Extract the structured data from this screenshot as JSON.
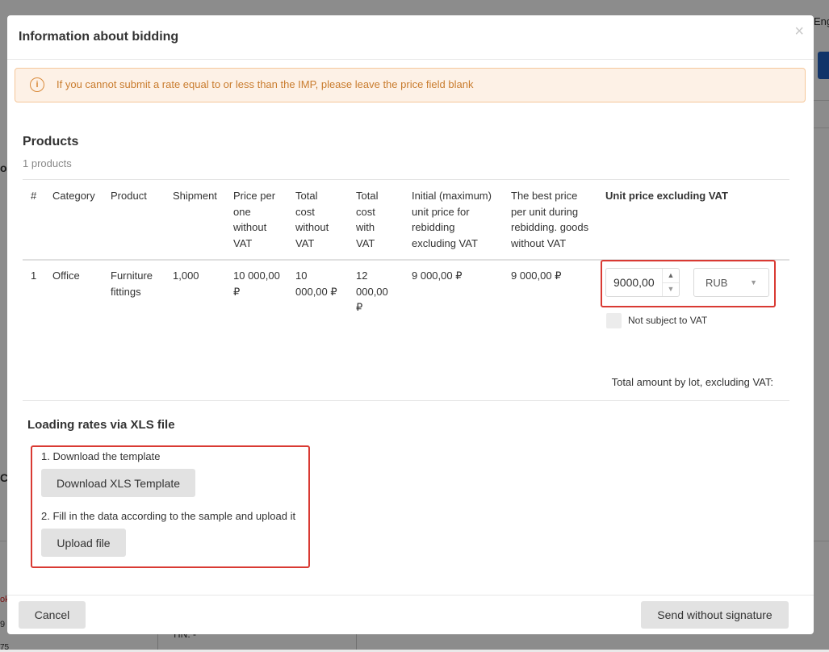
{
  "background": {
    "lang": "Eng",
    "frag_o": "o",
    "frag_c": "C",
    "frag_ok": "ok",
    "frag_9": "9",
    "frag_75": "75",
    "frag_tin": "TIN: -"
  },
  "modal": {
    "title": "Information about bidding",
    "close_icon": "×"
  },
  "alert": {
    "icon": "i",
    "text": "If you cannot submit a rate equal to or less than the IMP, please leave the price field blank"
  },
  "products": {
    "title": "Products",
    "count": "1 products",
    "headers": {
      "num": "#",
      "category": "Category",
      "product": "Product",
      "shipment": "Shipment",
      "price_per_one": [
        "Price per",
        "one",
        "without",
        "VAT"
      ],
      "total_without": [
        "Total",
        "cost",
        "without",
        "VAT"
      ],
      "total_with": [
        "Total",
        "cost",
        "with",
        "VAT"
      ],
      "initial_max": [
        "Initial (maximum)",
        "unit price for",
        "rebidding",
        "excluding VAT"
      ],
      "best_price": [
        "The best price",
        "per unit during",
        "rebidding. goods",
        "without VAT"
      ],
      "unit_price": "Unit price excluding VAT"
    },
    "row": {
      "num": "1",
      "category": "Office",
      "product": [
        "Furniture",
        "fittings"
      ],
      "shipment": "1,000",
      "price_per_one": [
        "10 000,00",
        "₽"
      ],
      "total_without": [
        "10",
        "000,00 ₽"
      ],
      "total_with": [
        "12",
        "000,00",
        "₽"
      ],
      "initial_max": "9 000,00 ₽",
      "best_price": "9 000,00 ₽",
      "unit_price_value": "9000,00",
      "currency": "RUB",
      "not_subject_vat": "Not subject to VAT"
    },
    "total_label": "Total amount by lot, excluding VAT:"
  },
  "xls": {
    "title": "Loading rates via XLS file",
    "step1": "1. Download the template",
    "download_label": "Download XLS Template",
    "step2": "2. Fill in the data according to the sample and upload it",
    "upload_label": "Upload file"
  },
  "footer": {
    "cancel_label": "Cancel",
    "send_label": "Send without signature"
  },
  "colors": {
    "highlight": "#d93a33",
    "alert_text": "#c97c2e",
    "alert_bg": "#fdf1e6"
  }
}
